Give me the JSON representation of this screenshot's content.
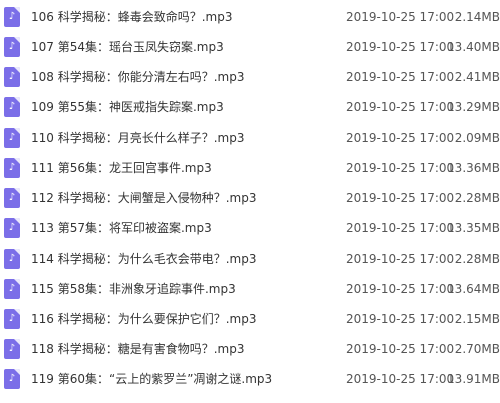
{
  "icon": "music-file-icon",
  "accent_color": "#7b6ee8",
  "files": [
    {
      "name": "106 科学揭秘：蜂毒会致命吗？.mp3",
      "date": "2019-10-25 17:00",
      "size": "2.14MB"
    },
    {
      "name": "107 第54集：瑶台玉凤失窃案.mp3",
      "date": "2019-10-25 17:00",
      "size": "13.40MB"
    },
    {
      "name": "108 科学揭秘：你能分清左右吗？.mp3",
      "date": "2019-10-25 17:00",
      "size": "2.41MB"
    },
    {
      "name": "109 第55集：神医戒指失踪案.mp3",
      "date": "2019-10-25 17:00",
      "size": "13.29MB"
    },
    {
      "name": "110 科学揭秘：月亮长什么样子？.mp3",
      "date": "2019-10-25 17:00",
      "size": "2.09MB"
    },
    {
      "name": "111 第56集：龙王回宫事件.mp3",
      "date": "2019-10-25 17:00",
      "size": "13.36MB"
    },
    {
      "name": "112 科学揭秘：大闸蟹是入侵物种？.mp3",
      "date": "2019-10-25 17:00",
      "size": "2.28MB"
    },
    {
      "name": "113 第57集：将军印被盗案.mp3",
      "date": "2019-10-25 17:00",
      "size": "13.35MB"
    },
    {
      "name": "114 科学揭秘：为什么毛衣会带电？.mp3",
      "date": "2019-10-25 17:00",
      "size": "2.28MB"
    },
    {
      "name": "115 第58集：非洲象牙追踪事件.mp3",
      "date": "2019-10-25 17:00",
      "size": "13.64MB"
    },
    {
      "name": "116 科学揭秘：为什么要保护它们？.mp3",
      "date": "2019-10-25 17:00",
      "size": "2.15MB"
    },
    {
      "name": "118 科学揭秘：糖是有害食物吗？.mp3",
      "date": "2019-10-25 17:00",
      "size": "2.70MB"
    },
    {
      "name": "119 第60集：“云上的紫罗兰”凋谢之谜.mp3",
      "date": "2019-10-25 17:00",
      "size": "13.91MB"
    }
  ]
}
